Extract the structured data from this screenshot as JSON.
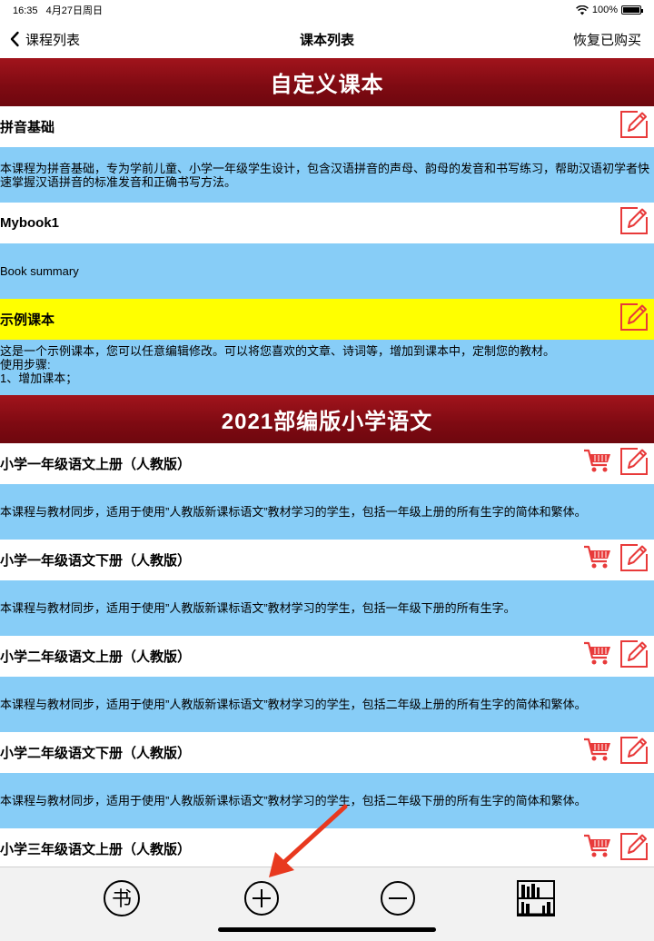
{
  "status_bar": {
    "time": "16:35",
    "date": "4月27日周日",
    "battery": "100%"
  },
  "nav": {
    "back_label": "课程列表",
    "title": "课本列表",
    "right_label": "恢复已购买"
  },
  "sections": [
    {
      "title": "自定义课本",
      "books": [
        {
          "title": "拼音基础",
          "desc": "本课程为拼音基础，专为学前儿童、小学一年级学生设计，包含汉语拼音的声母、韵母的发音和书写练习，帮助汉语初学者快速掌握汉语拼音的标准发音和正确书写方法。",
          "cart": false,
          "highlight": false
        },
        {
          "title": "Mybook1",
          "desc": "Book summary",
          "cart": false,
          "highlight": false
        },
        {
          "title": "示例课本",
          "desc_lines": [
            "这是一个示例课本，您可以任意编辑修改。可以将您喜欢的文章、诗词等，增加到课本中，定制您的教材。",
            "使用步骤:",
            "1、增加课本；"
          ],
          "cart": false,
          "highlight": true
        }
      ]
    },
    {
      "title": "2021部编版小学语文",
      "books": [
        {
          "title": "小学一年级语文上册（人教版）",
          "desc": "本课程与教材同步，适用于使用”人教版新课标语文”教材学习的学生，包括一年级上册的所有生字的简体和繁体。",
          "cart": true
        },
        {
          "title": "小学一年级语文下册（人教版）",
          "desc": "本课程与教材同步，适用于使用”人教版新课标语文”教材学习的学生，包括一年级下册的所有生字。",
          "cart": true
        },
        {
          "title": "小学二年级语文上册（人教版）",
          "desc": "本课程与教材同步，适用于使用”人教版新课标语文”教材学习的学生，包括二年级上册的所有生字的简体和繁体。",
          "cart": true
        },
        {
          "title": "小学二年级语文下册（人教版）",
          "desc": "本课程与教材同步，适用于使用”人教版新课标语文”教材学习的学生，包括二年级下册的所有生字的简体和繁体。",
          "cart": true
        },
        {
          "title": "小学三年级语文上册（人教版）",
          "cart": true
        }
      ]
    }
  ],
  "tab_bar": {
    "book_icon_char": "书",
    "items": [
      "book-circle-icon",
      "plus-circle-icon",
      "minus-circle-icon",
      "bookshelf-icon"
    ]
  },
  "colors": {
    "header_red": "#8f0f17",
    "desc_blue": "#87cdf7",
    "highlight_yellow": "#ffff00",
    "icon_red": "#e83a3a",
    "annotation_arrow": "#e8391f"
  }
}
